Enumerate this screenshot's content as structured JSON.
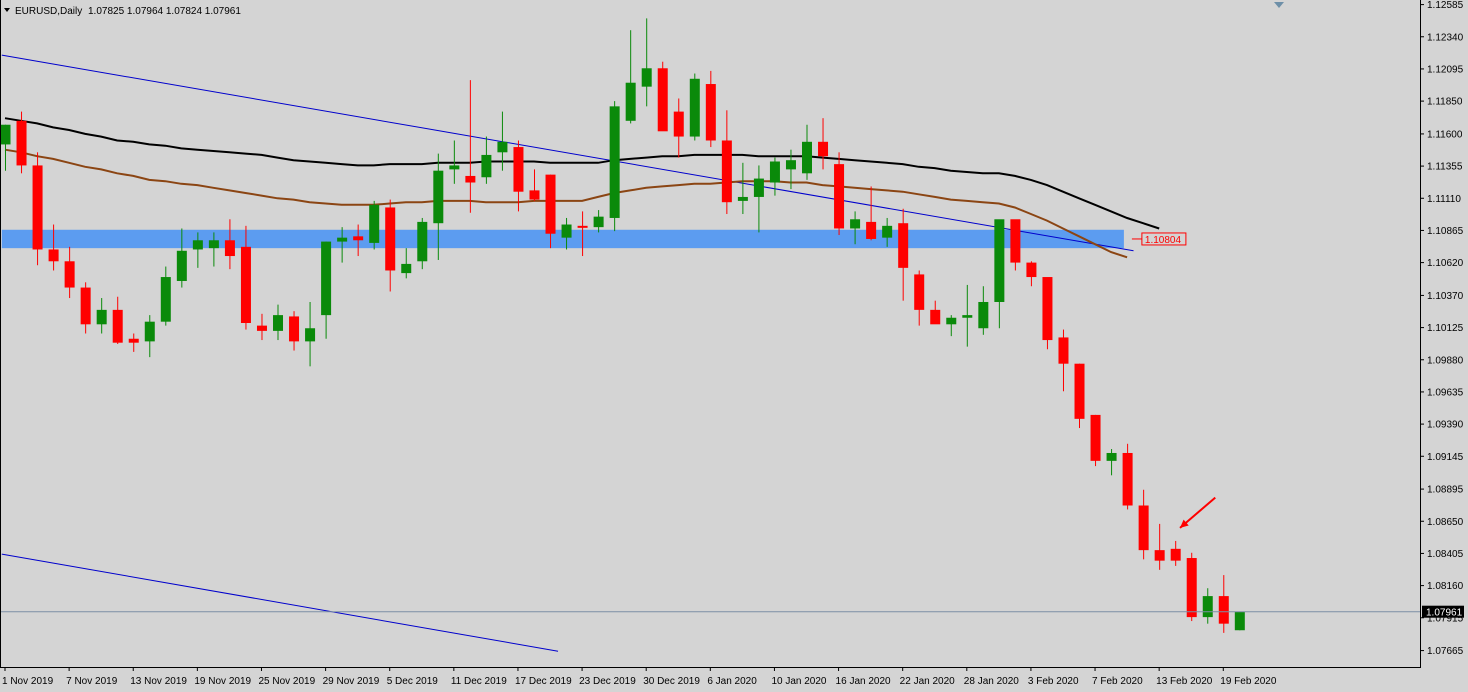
{
  "header": {
    "symbol": "EURUSD,Daily",
    "ohlc": "1.07825 1.07964 1.07824 1.07961"
  },
  "colors": {
    "background": "#d4d4d4",
    "bull": "#0a8a0a",
    "bear": "#ff0000",
    "ma_fast": "#8b4513",
    "ma_slow": "#000000",
    "trendline": "#0000cc",
    "zone": "#5c9cf0"
  },
  "chart_data": {
    "type": "candlestick",
    "symbol": "EURUSD",
    "timeframe": "Daily",
    "y_range": [
      1.0754,
      1.1262
    ],
    "y_ticks": [
      "1.12585",
      "1.12340",
      "1.12095",
      "1.11850",
      "1.11600",
      "1.11355",
      "1.11110",
      "1.10865",
      "1.10620",
      "1.10370",
      "1.10125",
      "1.09880",
      "1.09635",
      "1.09390",
      "1.09145",
      "1.08895",
      "1.08650",
      "1.08405",
      "1.08160",
      "1.07915",
      "1.07665"
    ],
    "x_labels": [
      {
        "i": 0,
        "label": "1 Nov 2019"
      },
      {
        "i": 4,
        "label": "7 Nov 2019"
      },
      {
        "i": 8,
        "label": "13 Nov 2019"
      },
      {
        "i": 12,
        "label": "19 Nov 2019"
      },
      {
        "i": 16,
        "label": "25 Nov 2019"
      },
      {
        "i": 20,
        "label": "29 Nov 2019"
      },
      {
        "i": 24,
        "label": "5 Dec 2019"
      },
      {
        "i": 28,
        "label": "11 Dec 2019"
      },
      {
        "i": 32,
        "label": "17 Dec 2019"
      },
      {
        "i": 36,
        "label": "23 Dec 2019"
      },
      {
        "i": 40,
        "label": "30 Dec 2019"
      },
      {
        "i": 44,
        "label": "6 Jan 2020"
      },
      {
        "i": 48,
        "label": "10 Jan 2020"
      },
      {
        "i": 52,
        "label": "16 Jan 2020"
      },
      {
        "i": 56,
        "label": "22 Jan 2020"
      },
      {
        "i": 60,
        "label": "28 Jan 2020"
      },
      {
        "i": 64,
        "label": "3 Feb 2020"
      },
      {
        "i": 68,
        "label": "7 Feb 2020"
      },
      {
        "i": 72,
        "label": "13 Feb 2020"
      },
      {
        "i": 76,
        "label": "19 Feb 2020"
      }
    ],
    "candles": [
      [
        1.1152,
        1.1167,
        1.1132,
        1.1167
      ],
      [
        1.117,
        1.1177,
        1.113,
        1.1136
      ],
      [
        1.1136,
        1.1146,
        1.106,
        1.1072
      ],
      [
        1.1072,
        1.1091,
        1.1056,
        1.1063
      ],
      [
        1.1063,
        1.1074,
        1.1035,
        1.1043
      ],
      [
        1.1043,
        1.1047,
        1.1008,
        1.1015
      ],
      [
        1.1015,
        1.1035,
        1.1008,
        1.1026
      ],
      [
        1.1026,
        1.1036,
        1.1,
        1.1001
      ],
      [
        1.1004,
        1.1008,
        1.0994,
        1.1001
      ],
      [
        1.1002,
        1.1022,
        1.099,
        1.1017
      ],
      [
        1.1017,
        1.1059,
        1.1014,
        1.1051
      ],
      [
        1.1048,
        1.1088,
        1.1043,
        1.1071
      ],
      [
        1.1072,
        1.1085,
        1.1058,
        1.1079
      ],
      [
        1.1073,
        1.1085,
        1.1059,
        1.1079
      ],
      [
        1.1079,
        1.1095,
        1.1057,
        1.1067
      ],
      [
        1.1074,
        1.109,
        1.1011,
        1.1016
      ],
      [
        1.1014,
        1.1023,
        1.1003,
        1.101
      ],
      [
        1.101,
        1.103,
        1.1003,
        1.1022
      ],
      [
        1.1021,
        1.1025,
        1.0995,
        1.1002
      ],
      [
        1.1002,
        1.1032,
        1.0983,
        1.1012
      ],
      [
        1.1022,
        1.1078,
        1.1004,
        1.1078
      ],
      [
        1.1078,
        1.1089,
        1.1062,
        1.1081
      ],
      [
        1.1082,
        1.1091,
        1.1067,
        1.1079
      ],
      [
        1.1077,
        1.1109,
        1.1072,
        1.1106
      ],
      [
        1.1104,
        1.111,
        1.104,
        1.1056
      ],
      [
        1.1054,
        1.1073,
        1.105,
        1.1061
      ],
      [
        1.1063,
        1.1096,
        1.1057,
        1.1093
      ],
      [
        1.1092,
        1.1145,
        1.1064,
        1.1132
      ],
      [
        1.1133,
        1.1155,
        1.1122,
        1.1136
      ],
      [
        1.1128,
        1.1201,
        1.11,
        1.1123
      ],
      [
        1.1127,
        1.1158,
        1.1122,
        1.1144
      ],
      [
        1.1146,
        1.1177,
        1.1132,
        1.1154
      ],
      [
        1.115,
        1.1155,
        1.1101,
        1.1116
      ],
      [
        1.1117,
        1.1133,
        1.1109,
        1.111
      ],
      [
        1.1129,
        1.1129,
        1.1073,
        1.1084
      ],
      [
        1.1081,
        1.1096,
        1.1072,
        1.1091
      ],
      [
        1.109,
        1.1101,
        1.1067,
        1.1089
      ],
      [
        1.1089,
        1.1102,
        1.1085,
        1.1097
      ],
      [
        1.1096,
        1.1185,
        1.1086,
        1.1181
      ],
      [
        1.117,
        1.1239,
        1.1168,
        1.1199
      ],
      [
        1.1196,
        1.1248,
        1.1181,
        1.121
      ],
      [
        1.121,
        1.1215,
        1.117,
        1.1162
      ],
      [
        1.1177,
        1.1187,
        1.1142,
        1.1158
      ],
      [
        1.1158,
        1.1206,
        1.1155,
        1.1202
      ],
      [
        1.1198,
        1.1208,
        1.115,
        1.1155
      ],
      [
        1.1155,
        1.1178,
        1.1099,
        1.1108
      ],
      [
        1.1109,
        1.1138,
        1.1099,
        1.1112
      ],
      [
        1.1112,
        1.1136,
        1.1085,
        1.1126
      ],
      [
        1.1123,
        1.1142,
        1.1113,
        1.1139
      ],
      [
        1.1133,
        1.1148,
        1.1118,
        1.114
      ],
      [
        1.113,
        1.1167,
        1.1125,
        1.1154
      ],
      [
        1.1154,
        1.1172,
        1.1133,
        1.1143
      ],
      [
        1.1137,
        1.1146,
        1.1083,
        1.1088
      ],
      [
        1.1088,
        1.1101,
        1.1076,
        1.1095
      ],
      [
        1.1093,
        1.112,
        1.1079,
        1.108
      ],
      [
        1.1081,
        1.1096,
        1.1074,
        1.109
      ],
      [
        1.1092,
        1.1103,
        1.1033,
        1.1058
      ],
      [
        1.1053,
        1.1056,
        1.1014,
        1.1026
      ],
      [
        1.1026,
        1.1033,
        1.1019,
        1.1015
      ],
      [
        1.1015,
        1.1022,
        1.1006,
        1.102
      ],
      [
        1.102,
        1.1045,
        1.0998,
        1.1022
      ],
      [
        1.1012,
        1.1044,
        1.1007,
        1.1032
      ],
      [
        1.1032,
        1.1093,
        1.1012,
        1.1095
      ],
      [
        1.1095,
        1.1089,
        1.1056,
        1.1062
      ],
      [
        1.1062,
        1.1063,
        1.1044,
        1.1051
      ],
      [
        1.1051,
        1.1049,
        1.0996,
        1.1003
      ],
      [
        1.1005,
        1.1011,
        1.0964,
        1.0985
      ],
      [
        1.0985,
        1.0985,
        1.0936,
        1.0943
      ],
      [
        1.0946,
        1.0946,
        1.0907,
        1.0911
      ],
      [
        1.0911,
        1.092,
        1.09,
        1.0917
      ],
      [
        1.0917,
        1.0924,
        1.0874,
        1.0877
      ],
      [
        1.0877,
        1.0889,
        1.0836,
        1.0843
      ],
      [
        1.0843,
        1.0863,
        1.0828,
        1.0835
      ],
      [
        1.0844,
        1.085,
        1.0831,
        1.0835
      ],
      [
        1.0837,
        1.0841,
        1.0789,
        1.0792
      ],
      [
        1.0792,
        1.0814,
        1.0787,
        1.0808
      ],
      [
        1.0808,
        1.0824,
        1.078,
        1.0787
      ],
      [
        1.0782,
        1.0796,
        1.0782,
        1.0796
      ]
    ],
    "ma_slow": [
      1.1172,
      1.117,
      1.1168,
      1.1165,
      1.1163,
      1.116,
      1.1158,
      1.1155,
      1.1154,
      1.1152,
      1.1151,
      1.1149,
      1.1148,
      1.1147,
      1.1146,
      1.1145,
      1.1144,
      1.1142,
      1.114,
      1.1139,
      1.1138,
      1.1137,
      1.1136,
      1.1136,
      1.1137,
      1.1137,
      1.1137,
      1.1138,
      1.1138,
      1.1138,
      1.1139,
      1.1139,
      1.1139,
      1.1139,
      1.1138,
      1.1138,
      1.1138,
      1.1138,
      1.114,
      1.1141,
      1.1142,
      1.1143,
      1.1143,
      1.1144,
      1.1144,
      1.1144,
      1.1144,
      1.1143,
      1.1143,
      1.1143,
      1.1143,
      1.1142,
      1.1141,
      1.114,
      1.1139,
      1.1138,
      1.1137,
      1.1135,
      1.1134,
      1.1132,
      1.1131,
      1.113,
      1.113,
      1.1128,
      1.1125,
      1.1121,
      1.1116,
      1.1111,
      1.1106,
      1.1101,
      1.1096,
      1.1092,
      1.1088
    ],
    "ma_fast": [
      1.1148,
      1.1146,
      1.1143,
      1.1141,
      1.1138,
      1.1135,
      1.1133,
      1.113,
      1.1128,
      1.1125,
      1.1124,
      1.1122,
      1.1121,
      1.1119,
      1.1117,
      1.1115,
      1.1113,
      1.1111,
      1.111,
      1.1108,
      1.1107,
      1.1106,
      1.1106,
      1.1106,
      1.1107,
      1.1108,
      1.1108,
      1.1109,
      1.1109,
      1.1109,
      1.1108,
      1.1108,
      1.1108,
      1.1109,
      1.1109,
      1.1109,
      1.1109,
      1.1112,
      1.1115,
      1.1117,
      1.1119,
      1.112,
      1.1121,
      1.1122,
      1.1122,
      1.1123,
      1.1124,
      1.1124,
      1.1124,
      1.1123,
      1.1123,
      1.1121,
      1.112,
      1.1119,
      1.1118,
      1.1117,
      1.1116,
      1.1114,
      1.1112,
      1.111,
      1.1109,
      1.1108,
      1.1107,
      1.1104,
      1.1099,
      1.1094,
      1.1088,
      1.1082,
      1.1076,
      1.107,
      1.1066
    ],
    "trendline_upper": {
      "from": [
        -0.2,
        1.122
      ],
      "to": [
        70.4,
        1.1071
      ]
    },
    "trendline_lower": {
      "from": [
        -0.2,
        1.084
      ],
      "to": [
        34.5,
        1.0766
      ]
    },
    "zone": {
      "from_i": -0.2,
      "to_i": 69.8,
      "low": 1.1073,
      "high": 1.1087
    },
    "zone_label": "1.10804",
    "current_price": 1.07961,
    "current_price_label": "1.07961",
    "arrow": {
      "from": [
        75.5,
        1.0883
      ],
      "to": [
        73.3,
        1.086
      ]
    }
  }
}
